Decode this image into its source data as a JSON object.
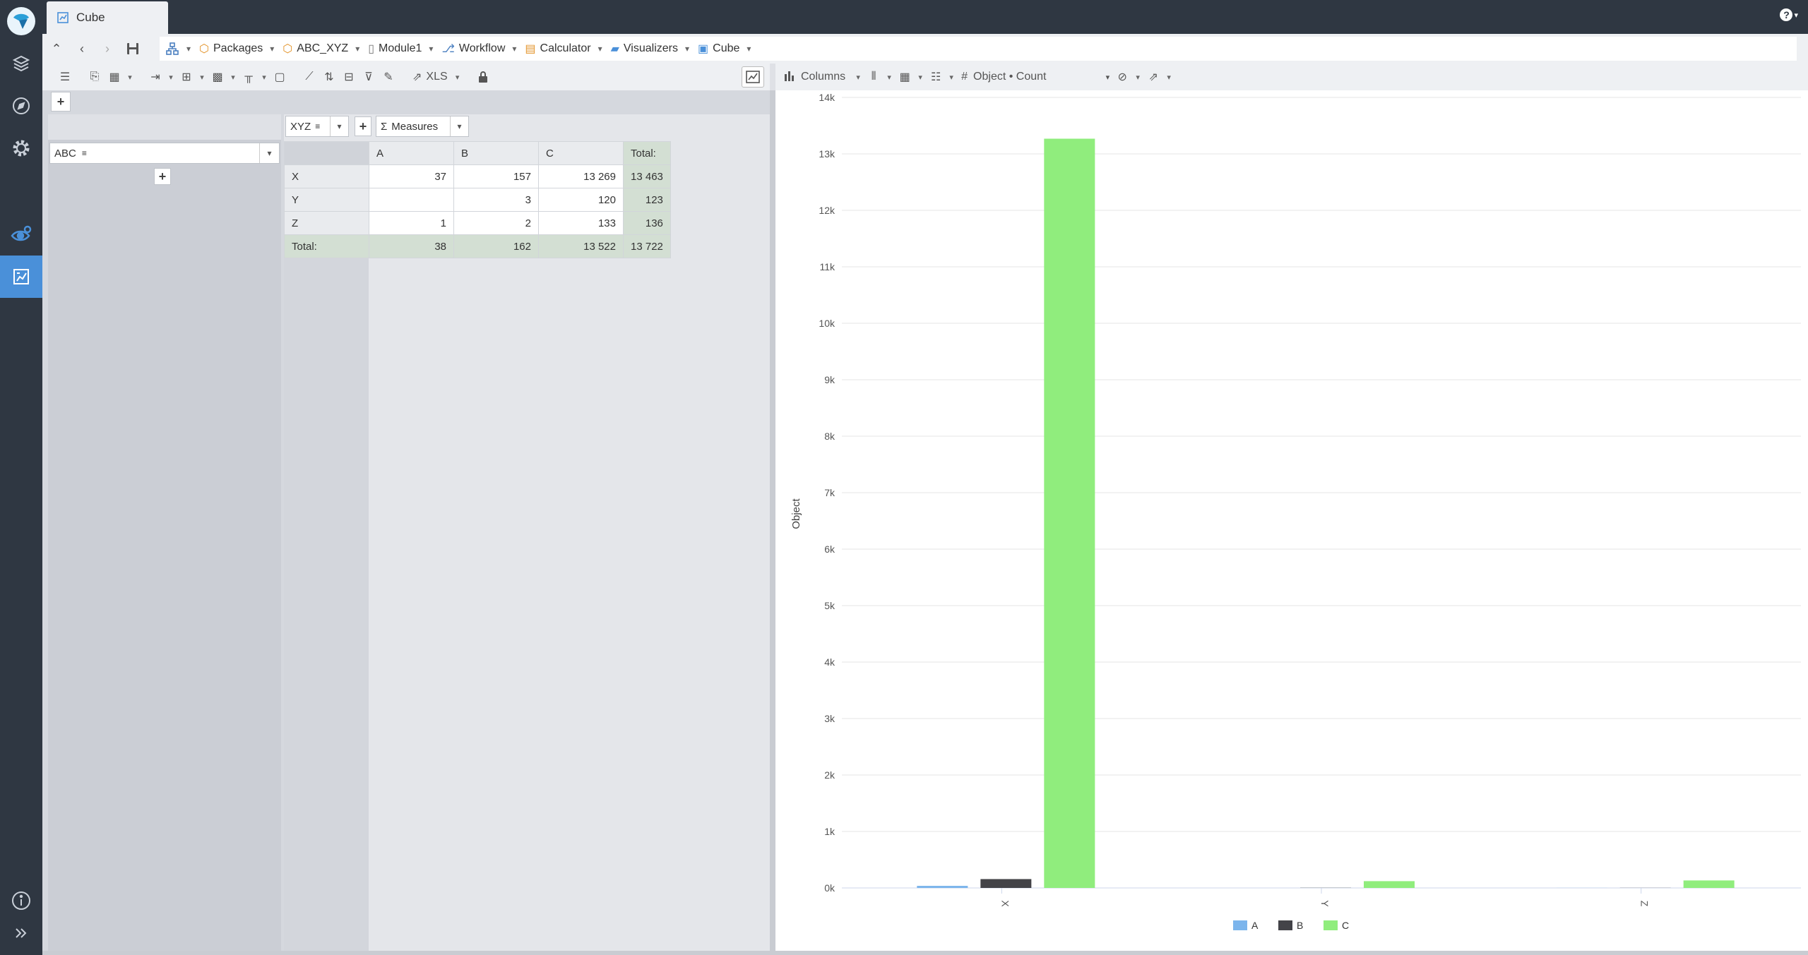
{
  "window": {
    "tab_title": "Cube",
    "help_label": "?"
  },
  "breadcrumb": [
    {
      "label": "Packages"
    },
    {
      "label": "ABC_XYZ"
    },
    {
      "label": "Module1"
    },
    {
      "label": "Workflow"
    },
    {
      "label": "Calculator"
    },
    {
      "label": "Visualizers"
    },
    {
      "label": "Cube"
    }
  ],
  "left_toolbar": {
    "export_label": "XLS"
  },
  "chart_toolbar": {
    "chart_type_label": "Columns",
    "measure_label": "Object • Count",
    "hash_label": "#"
  },
  "pivot": {
    "row_field": "ABC",
    "column_field": "XYZ",
    "measures_label": "Measures",
    "sigma": "Σ",
    "column_headers": [
      "A",
      "B",
      "C",
      "Total:"
    ],
    "rows": [
      {
        "label": "X",
        "values": [
          "37",
          "157",
          "13 269",
          "13 463"
        ]
      },
      {
        "label": "Y",
        "values": [
          "",
          "3",
          "120",
          "123"
        ]
      },
      {
        "label": "Z",
        "values": [
          "1",
          "2",
          "133",
          "136"
        ]
      }
    ],
    "total_row": {
      "label": "Total:",
      "values": [
        "38",
        "162",
        "13 522",
        "13 722"
      ]
    }
  },
  "chart_data": {
    "type": "bar",
    "categories": [
      "X",
      "Y",
      "Z"
    ],
    "series": [
      {
        "name": "A",
        "values": [
          37,
          0,
          1
        ],
        "color": "#7cb5ec"
      },
      {
        "name": "B",
        "values": [
          157,
          3,
          2
        ],
        "color": "#434348"
      },
      {
        "name": "C",
        "values": [
          13269,
          120,
          133
        ],
        "color": "#90ed7d"
      }
    ],
    "ylabel": "Object",
    "xlabel": "",
    "ylim": [
      0,
      14000
    ],
    "yticks": [
      0,
      1000,
      2000,
      3000,
      4000,
      5000,
      6000,
      7000,
      8000,
      9000,
      10000,
      11000,
      12000,
      13000,
      14000
    ],
    "ytick_labels": [
      "0k",
      "1k",
      "2k",
      "3k",
      "4k",
      "5k",
      "6k",
      "7k",
      "8k",
      "9k",
      "10k",
      "11k",
      "12k",
      "13k",
      "14k"
    ],
    "grid": true,
    "legend": "bottom"
  }
}
